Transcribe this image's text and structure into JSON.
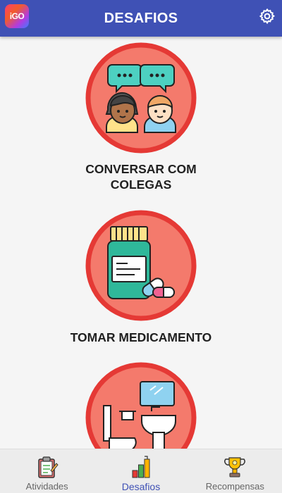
{
  "app": {
    "logo_text": "iGO",
    "title": "DESAFIOS"
  },
  "colors": {
    "appbar": "#3f51b5",
    "circle_fill": "#f47a6c",
    "circle_ring": "#e53935",
    "active_tab": "#3f51b5"
  },
  "challenges": [
    {
      "label": "CONVERSAR COM\nCOLEGAS",
      "icon": "chat-people-icon"
    },
    {
      "label": "TOMAR MEDICAMENTO",
      "icon": "medicine-bottle-icon"
    },
    {
      "label": "",
      "icon": "bathroom-icon"
    }
  ],
  "nav": {
    "items": [
      {
        "label": "Atividades",
        "icon": "clipboard-icon",
        "active": false
      },
      {
        "label": "Desafios",
        "icon": "chart-icon",
        "active": true
      },
      {
        "label": "Recompensas",
        "icon": "trophy-icon",
        "active": false
      }
    ]
  }
}
